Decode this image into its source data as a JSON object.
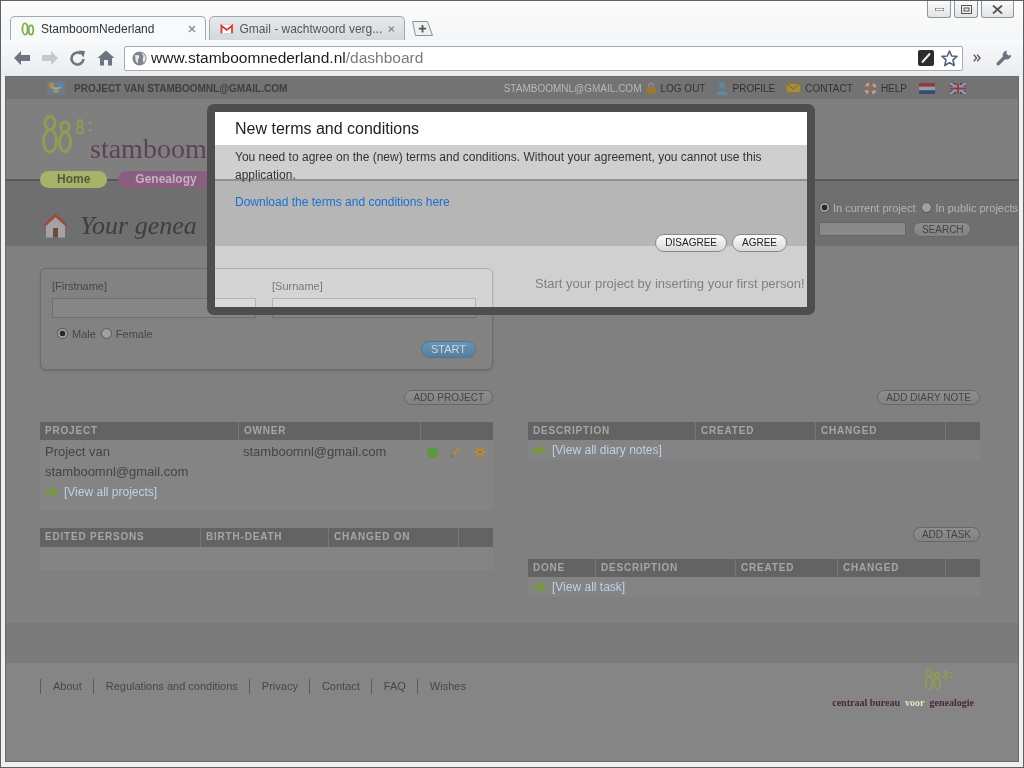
{
  "browser": {
    "tabs": [
      {
        "kind": "site",
        "title": "StamboomNederland",
        "selected": true
      },
      {
        "kind": "mail",
        "title": "Gmail - wachtwoord verg...",
        "selected": false
      }
    ],
    "nav_buttons": [
      {
        "kind": "back",
        "disabled": false
      },
      {
        "kind": "forward",
        "disabled": true
      },
      {
        "kind": "reload",
        "disabled": false
      },
      {
        "kind": "home",
        "disabled": false
      }
    ],
    "address": {
      "host": "www.stamboomnederland.nl",
      "path": "/dashboard"
    }
  },
  "top_bar": {
    "project": "PROJECT VAN STAMBOOMNL@GMAIL.COM",
    "user": "STAMBOOMNL@GMAIL.COM",
    "links": [
      {
        "kind": "logout",
        "label": "LOG OUT"
      },
      {
        "kind": "profile",
        "label": "PROFILE"
      },
      {
        "kind": "contact",
        "label": "CONTACT"
      },
      {
        "kind": "help",
        "label": "HELP"
      }
    ],
    "languages": [
      {
        "kind": "nl"
      },
      {
        "kind": "en"
      }
    ]
  },
  "header": {
    "logo_text": "stamboom",
    "nav": [
      {
        "label": "Home",
        "color": "#a5b36b"
      },
      {
        "label": "Genealogy",
        "color": "#8a5e80"
      }
    ],
    "title": "Your genea"
  },
  "search": {
    "scopes": [
      {
        "label": "In current project",
        "selected": true
      },
      {
        "label": "In public projects",
        "selected": false
      }
    ],
    "button": "SEARCH"
  },
  "new_person": {
    "fields": [
      {
        "label": "[Firstname]"
      },
      {
        "label": "[Surname]"
      }
    ],
    "genders": [
      {
        "label": "Male",
        "selected": true
      },
      {
        "label": "Female",
        "selected": false
      }
    ],
    "button": "START"
  },
  "hint": "Start your project by inserting your first person!",
  "projects": {
    "button": "ADD PROJECT",
    "columns": [
      "PROJECT",
      "OWNER"
    ],
    "rows": [
      {
        "project": "Project van stamboomnl@gmail.com",
        "owner": "stamboomnl@gmail.com"
      }
    ],
    "view_all": "[View all projects]"
  },
  "diary": {
    "button": "ADD DIARY NOTE",
    "columns": [
      "DESCRIPTION",
      "CREATED",
      "CHANGED"
    ],
    "view_all": "[View all diary notes]"
  },
  "edited_persons": {
    "columns": [
      "EDITED PERSONS",
      "BIRTH-DEATH",
      "CHANGED ON"
    ]
  },
  "tasks": {
    "button": "ADD TASK",
    "columns": [
      "DONE",
      "DESCRIPTION",
      "CREATED",
      "CHANGED"
    ],
    "view_all": "[View all task]"
  },
  "footer": {
    "links": [
      "About",
      "Regulations and conditions",
      "Privacy",
      "Contact",
      "FAQ",
      "Wishes"
    ],
    "logo_words": [
      "centraal bureau",
      "voor",
      "genealogie"
    ]
  },
  "dialog": {
    "title": "New terms and conditions",
    "message": "You need to agree on the (new) terms and conditions. Without your agreement, you cannot use this application.",
    "link": "Download the terms and conditions here",
    "buttons": [
      "DISAGREE",
      "AGREE"
    ]
  }
}
